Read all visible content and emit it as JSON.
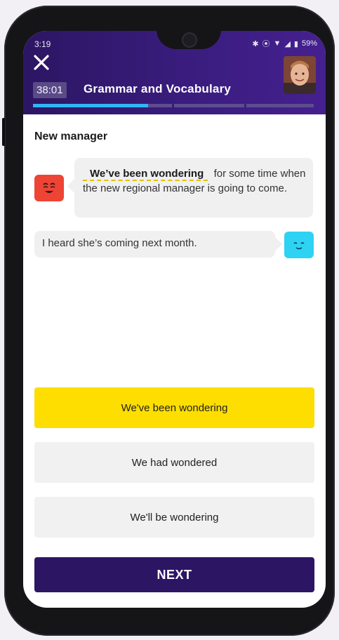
{
  "status_bar": {
    "time": "3:19",
    "battery": "59%"
  },
  "header": {
    "timer": "38:01",
    "title": "Grammar and Vocabulary",
    "progress_fraction": 0.41,
    "progress_segments": 4
  },
  "section": {
    "title": "New manager"
  },
  "dialogue": {
    "left": {
      "answer": "We’ve been wondering",
      "rest": "for some time when the new regional manager is going to come."
    },
    "right": {
      "text": "I heard she’s coming next month."
    }
  },
  "options": [
    {
      "label": "We've been wondering",
      "selected": true
    },
    {
      "label": "We had wondered",
      "selected": false
    },
    {
      "label": "We'll be wondering",
      "selected": false
    }
  ],
  "next_button": {
    "label": "NEXT"
  },
  "colors": {
    "header_purple": "#2c1663",
    "progress_blue": "#31b5f3",
    "selected_yellow": "#fede00",
    "face_red": "#ee4435",
    "face_blue": "#2ed2f3"
  }
}
